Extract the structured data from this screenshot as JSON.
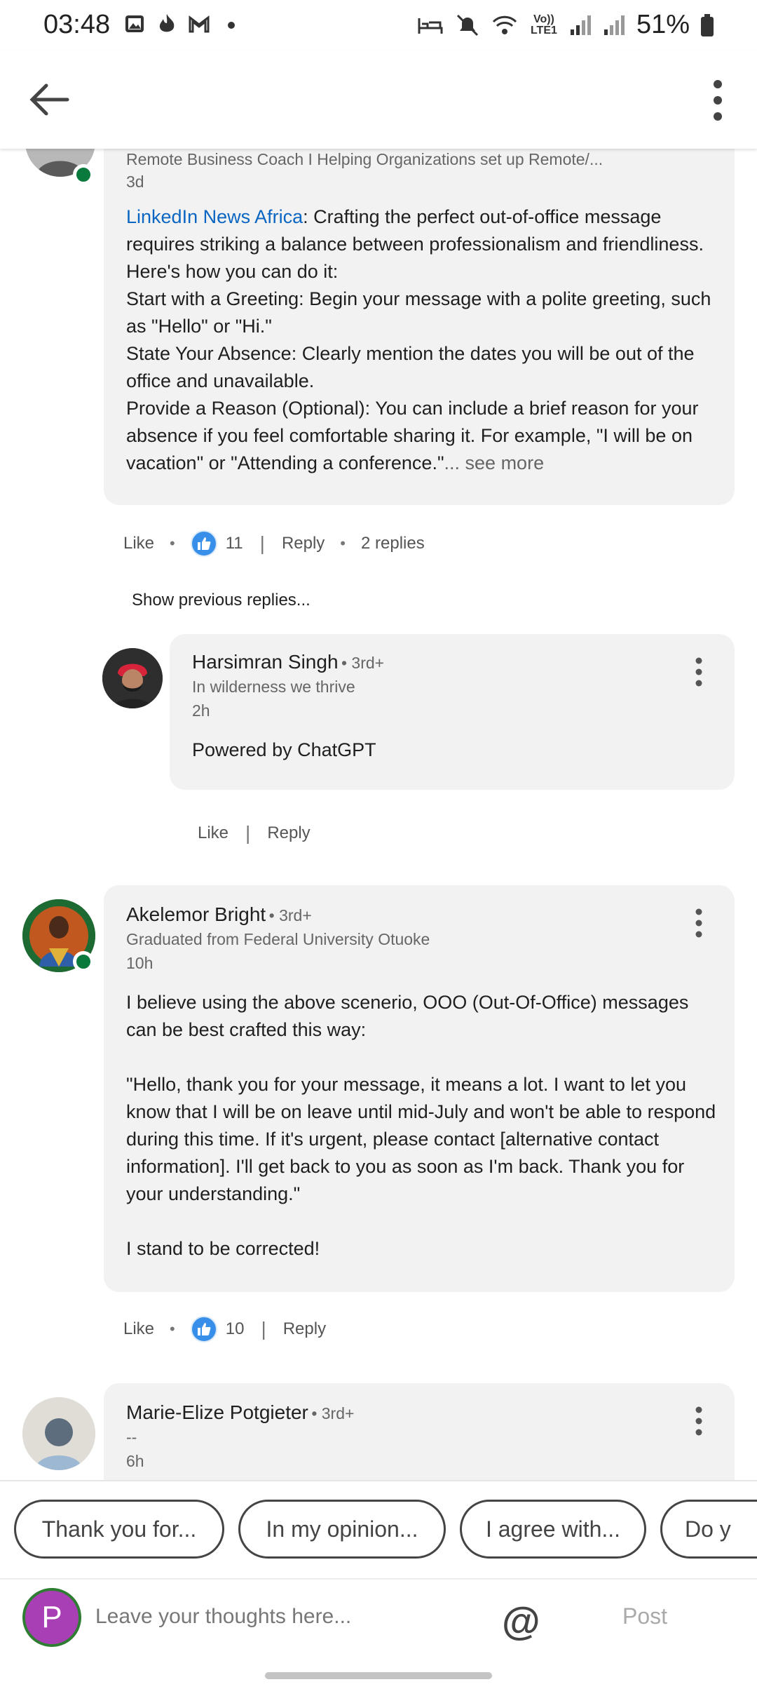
{
  "status_bar": {
    "time": "03:48",
    "battery": "51%",
    "network_label": "Vo)) LTE1",
    "icons_left": [
      "gallery-icon",
      "flame-icon",
      "gmail-icon",
      "dot-icon"
    ],
    "icons_right": [
      "sleep-icon",
      "mute-icon",
      "wifi-icon",
      "signal-icon",
      "battery-icon"
    ]
  },
  "appbar": {
    "back_icon": "arrow-left-icon",
    "more_icon": "more-vertical-icon"
  },
  "comments": [
    {
      "headline": "Remote Business Coach I Helping Organizations set up Remote/...",
      "time": "3d",
      "mention": "LinkedIn News Africa",
      "text": ": Crafting the perfect out-of-office message requires striking a balance between professionalism and friendliness. Here's how you can do it:\nStart with a Greeting: Begin your message with a polite greeting, such as \"Hello\" or \"Hi.\"\nState Your Absence: Clearly mention the dates you will be out of the office and unavailable.\nProvide a Reason (Optional): You can include a brief reason for your absence if you feel comfortable sharing it. For example, \"I will be on vacation\" or \"Attending a conference.\"",
      "see_more": "... see more",
      "like_label": "Like",
      "like_count": "11",
      "reply_label": "Reply",
      "replies_label": "2 replies"
    },
    {
      "name": "Akelemor Bright",
      "degree": "• 3rd+",
      "headline": "Graduated from Federal University Otuoke",
      "time": "10h",
      "text": "I believe using the above scenerio, OOO (Out-Of-Office) messages can be best crafted this way:\n\n\"Hello, thank you for your message, it means a lot. I want to let you know that I will be on leave until mid-July and won't be able to respond during this time. If it's urgent, please contact [alternative contact information]. I'll get back to you as soon as I'm back. Thank you for your understanding.\"\n\nI stand to be corrected!",
      "like_label": "Like",
      "like_count": "10",
      "reply_label": "Reply"
    },
    {
      "name": "Marie-Elize Potgieter",
      "degree": "• 3rd+",
      "headline": "--",
      "time": "6h"
    }
  ],
  "show_previous_replies": "Show previous replies...",
  "reply": {
    "name": "Harsimran Singh",
    "degree": "• 3rd+",
    "headline": "In wilderness we thrive",
    "time": "2h",
    "text": "Powered by ChatGPT",
    "like_label": "Like",
    "reply_label": "Reply"
  },
  "chips": [
    "Thank you for...",
    "In my opinion...",
    "I agree with...",
    "Do y"
  ],
  "composer": {
    "avatar_letter": "P",
    "placeholder": "Leave your thoughts here...",
    "at_symbol": "@",
    "post_label": "Post"
  },
  "colors": {
    "link": "#0a66c2",
    "bubble": "#f2f2f2",
    "online": "#0a7a3c",
    "like_blue": "#378fe9",
    "composer_avatar": "#a93fb5"
  }
}
